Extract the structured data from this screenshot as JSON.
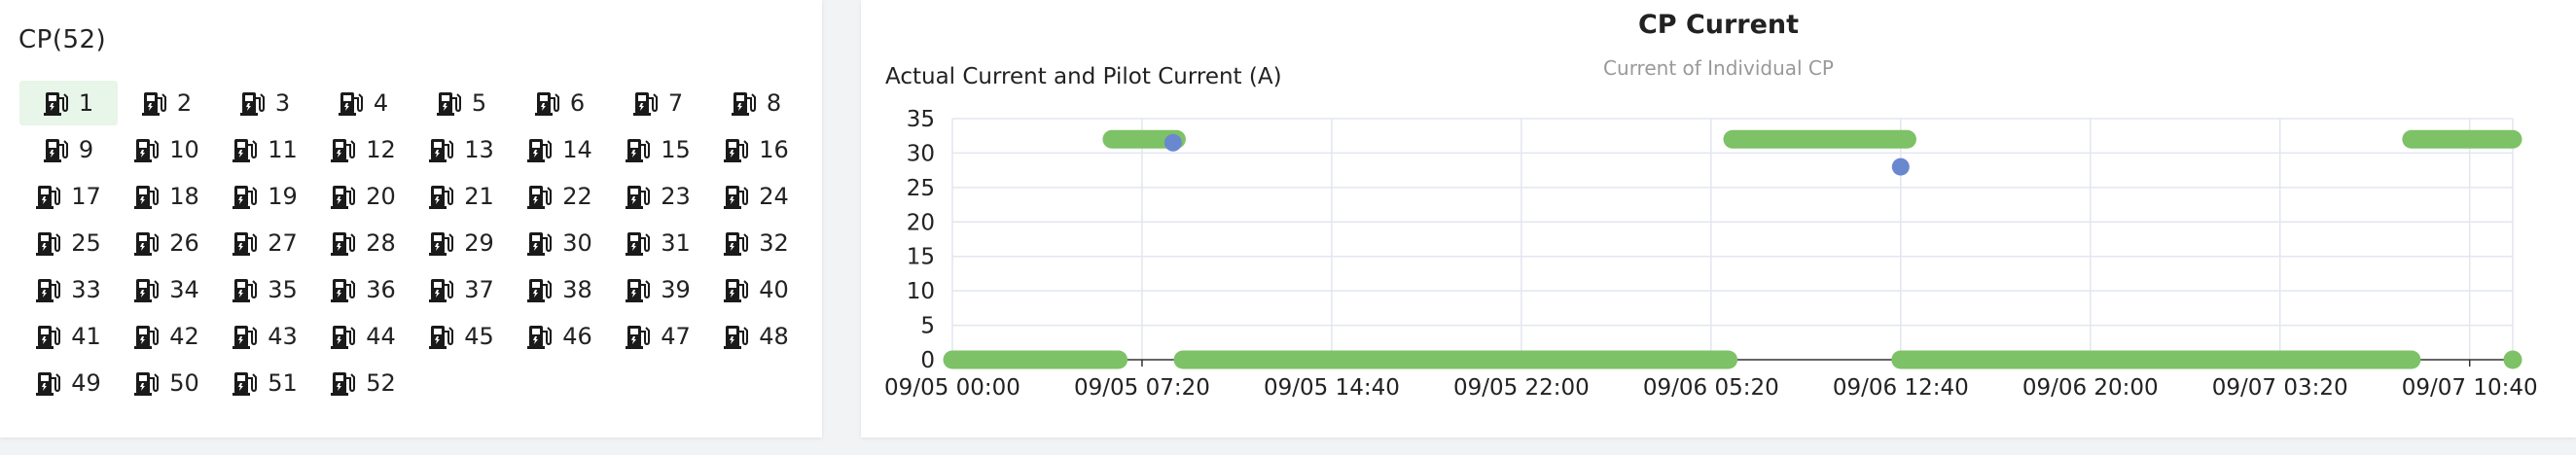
{
  "cp_panel": {
    "title": "CP(52)",
    "selected": "1",
    "items": [
      "1",
      "2",
      "3",
      "4",
      "5",
      "6",
      "7",
      "8",
      "9",
      "10",
      "11",
      "12",
      "13",
      "14",
      "15",
      "16",
      "17",
      "18",
      "19",
      "20",
      "21",
      "22",
      "23",
      "24",
      "25",
      "26",
      "27",
      "28",
      "29",
      "30",
      "31",
      "32",
      "33",
      "34",
      "35",
      "36",
      "37",
      "38",
      "39",
      "40",
      "41",
      "42",
      "43",
      "44",
      "45",
      "46",
      "47",
      "48",
      "49",
      "50",
      "51",
      "52"
    ]
  },
  "chart": {
    "title": "CP Current",
    "subtitle": "Current of Individual CP",
    "ylabel": "Actual Current and Pilot Current (A)"
  },
  "colors": {
    "green_series": "#7dc266",
    "blue_series": "#6a88d0",
    "grid": "#e3e6f0",
    "axis": "#333333",
    "selected_bg": "#e8f5e9"
  },
  "chart_data": {
    "type": "scatter",
    "x_unit": "minutes since 09/05 00:00",
    "xlim": [
      0,
      3620
    ],
    "ylim": [
      0,
      35
    ],
    "y_ticks": [
      0,
      5,
      10,
      15,
      20,
      25,
      30,
      35
    ],
    "x_ticks": [
      {
        "value": 0,
        "label": "09/05 00:00"
      },
      {
        "value": 440,
        "label": "09/05 07:20"
      },
      {
        "value": 880,
        "label": "09/05 14:40"
      },
      {
        "value": 1320,
        "label": "09/05 22:00"
      },
      {
        "value": 1760,
        "label": "09/06 05:20"
      },
      {
        "value": 2200,
        "label": "09/06 12:40"
      },
      {
        "value": 2640,
        "label": "09/06 20:00"
      },
      {
        "value": 3080,
        "label": "09/07 03:20"
      },
      {
        "value": 3520,
        "label": "09/07 10:40"
      }
    ],
    "grid": true,
    "series": [
      {
        "color": "green",
        "segments": [
          {
            "x_start": 0,
            "x_end": 385,
            "y": 0
          },
          {
            "x_start": 370,
            "x_end": 520,
            "y": 32
          },
          {
            "x_start": 535,
            "x_end": 1800,
            "y": 0
          },
          {
            "x_start": 1810,
            "x_end": 2215,
            "y": 32
          },
          {
            "x_start": 2200,
            "x_end": 3385,
            "y": 0
          },
          {
            "x_start": 3385,
            "x_end": 3720,
            "y": 32
          },
          {
            "x_start": 3720,
            "x_end": 3720,
            "y": 0
          }
        ]
      },
      {
        "color": "blue",
        "points": [
          {
            "x": 512,
            "y": 31.5
          },
          {
            "x": 2200,
            "y": 28
          }
        ]
      }
    ]
  }
}
